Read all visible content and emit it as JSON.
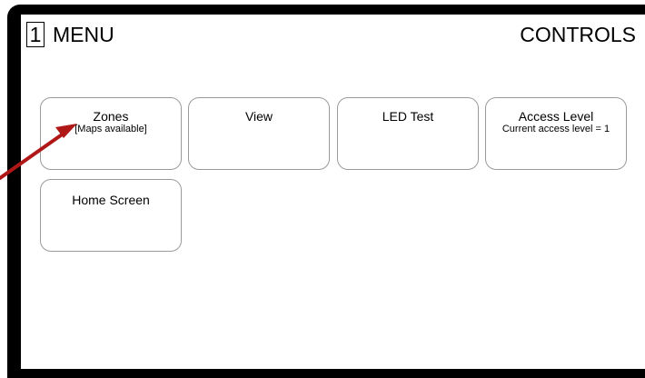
{
  "header": {
    "menu_number": "1",
    "menu_title": "MENU",
    "section_title": "CONTROLS"
  },
  "tiles": [
    {
      "label": "Zones",
      "sub": "[Maps available]"
    },
    {
      "label": "View",
      "sub": ""
    },
    {
      "label": "LED Test",
      "sub": ""
    },
    {
      "label": "Access Level",
      "sub": "Current access level = 1"
    },
    {
      "label": "Home Screen",
      "sub": ""
    }
  ],
  "annotation": {
    "arrow_color": "#b01818",
    "points_to": "zones-button"
  }
}
